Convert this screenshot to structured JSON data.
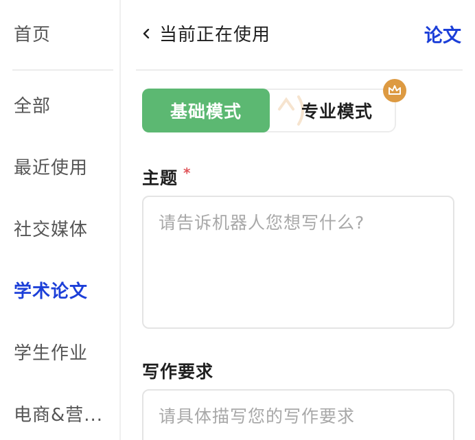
{
  "sidebar": {
    "items": [
      {
        "label": "首页",
        "active": false
      },
      {
        "label": "全部",
        "active": false
      },
      {
        "label": "最近使用",
        "active": false
      },
      {
        "label": "社交媒体",
        "active": false
      },
      {
        "label": "学术论文",
        "active": true
      },
      {
        "label": "学生作业",
        "active": false
      },
      {
        "label": "电商&营...",
        "active": false
      }
    ]
  },
  "header": {
    "back_label": "当前正在使用",
    "title": "论文"
  },
  "mode": {
    "basic_label": "基础模式",
    "pro_label": "专业模式",
    "selected": "basic",
    "pro_badge_icon": "crown-icon"
  },
  "form": {
    "topic": {
      "label": "主题",
      "required_mark": "*",
      "value": "",
      "placeholder": "请告诉机器人您想写什么?"
    },
    "requirements": {
      "label": "写作要求",
      "value": "",
      "placeholder": "请具体描写您的写作要求"
    }
  },
  "colors": {
    "accent_blue": "#1c3fd8",
    "basic_green": "#5cb872",
    "crown_orange": "#dd9a42",
    "required_red": "#e0555a"
  }
}
